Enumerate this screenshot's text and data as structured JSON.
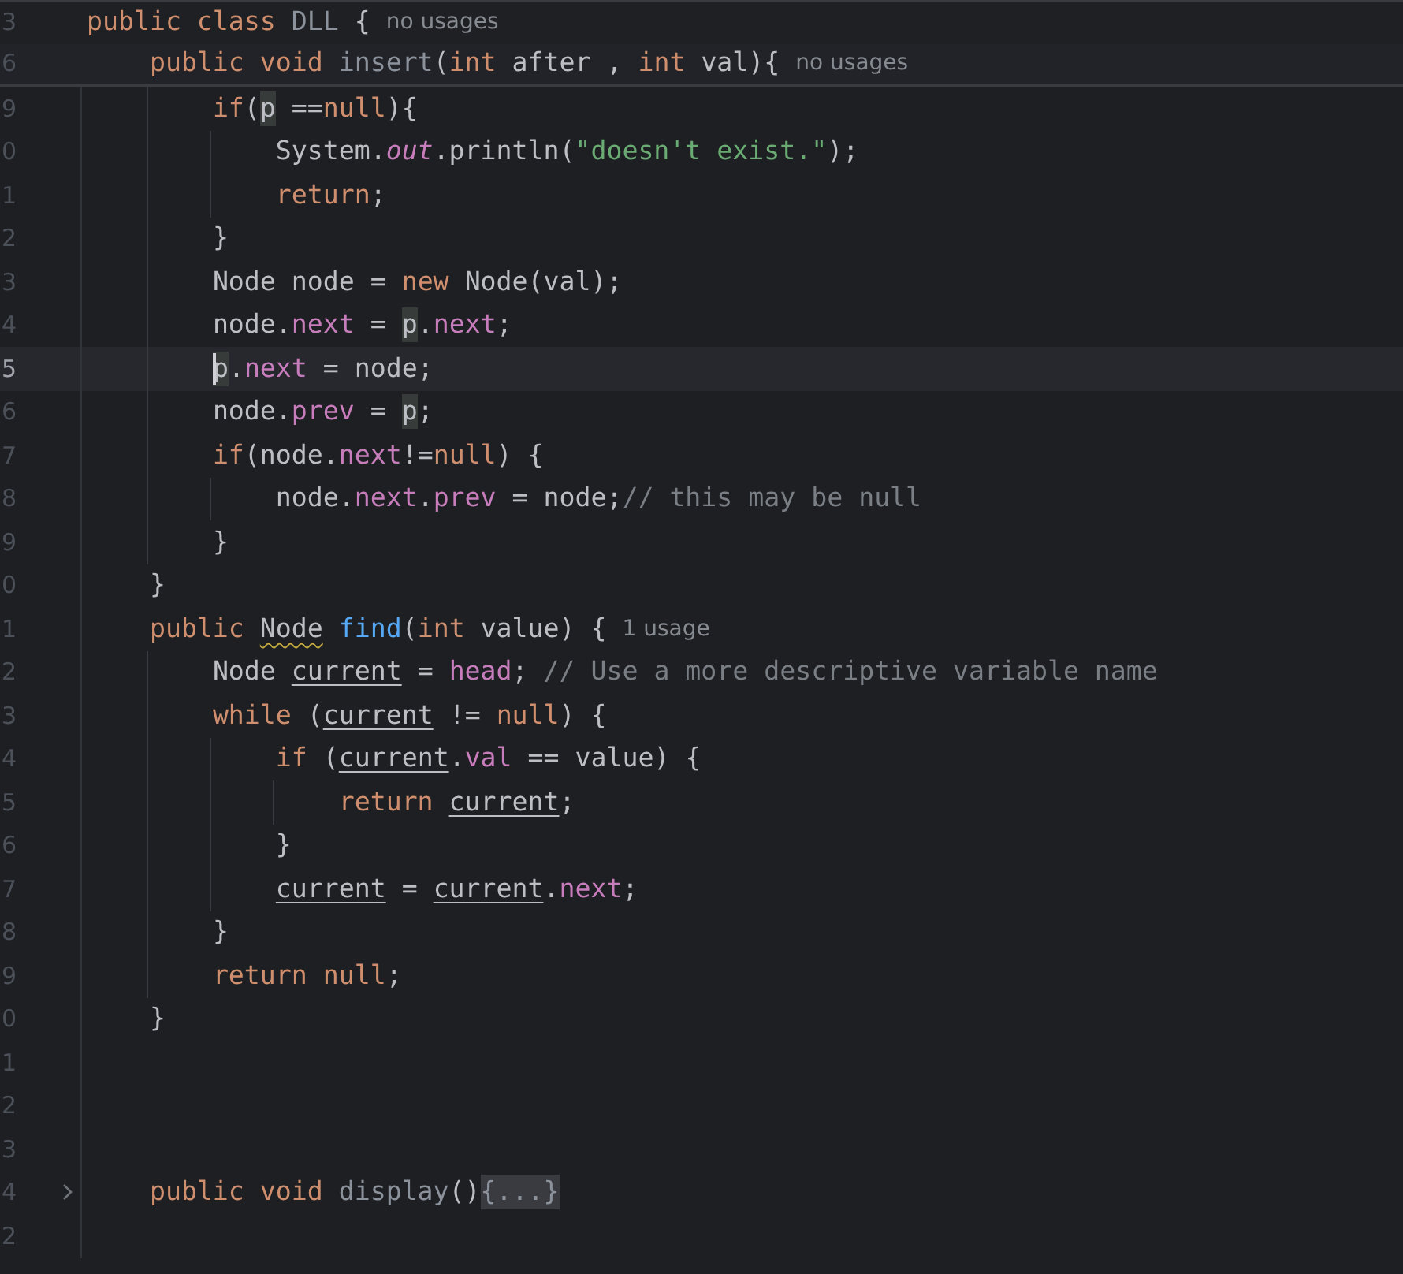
{
  "sticky_lines": [
    {
      "no": "3",
      "current": false,
      "folded": false,
      "tokens": [
        {
          "t": "public class ",
          "kind": "kw"
        },
        {
          "t": "DLL",
          "kind": "dim"
        },
        {
          "t": " {",
          "kind": "txt"
        },
        {
          "t": "no usages",
          "kind": "hint"
        }
      ]
    },
    {
      "no": "6",
      "current": false,
      "folded": false,
      "tokens": [
        {
          "t": "    public void ",
          "kind": "kw"
        },
        {
          "t": "insert",
          "kind": "dim"
        },
        {
          "t": "(",
          "kind": "txt"
        },
        {
          "t": "int ",
          "kind": "kw"
        },
        {
          "t": "after , ",
          "kind": "txt"
        },
        {
          "t": "int ",
          "kind": "kw"
        },
        {
          "t": "val){",
          "kind": "txt"
        },
        {
          "t": "no usages",
          "kind": "hint"
        }
      ]
    }
  ],
  "lines": [
    {
      "no": "9",
      "current": false,
      "folded": false,
      "tokens": [
        {
          "t": "        if",
          "kind": "kw"
        },
        {
          "t": "(",
          "kind": "txt"
        },
        {
          "t": "p",
          "kind": "occ"
        },
        {
          "t": " ==",
          "kind": "txt"
        },
        {
          "t": "null",
          "kind": "kw"
        },
        {
          "t": "){",
          "kind": "txt"
        }
      ]
    },
    {
      "no": "0",
      "current": false,
      "folded": false,
      "tokens": [
        {
          "t": "            System.",
          "kind": "txt"
        },
        {
          "t": "out",
          "kind": "static"
        },
        {
          "t": ".println(",
          "kind": "txt"
        },
        {
          "t": "\"doesn't exist.\"",
          "kind": "str"
        },
        {
          "t": ");",
          "kind": "txt"
        }
      ]
    },
    {
      "no": "1",
      "current": false,
      "folded": false,
      "tokens": [
        {
          "t": "            return",
          "kind": "kw"
        },
        {
          "t": ";",
          "kind": "txt"
        }
      ]
    },
    {
      "no": "2",
      "current": false,
      "folded": false,
      "tokens": [
        {
          "t": "        }",
          "kind": "txt"
        }
      ]
    },
    {
      "no": "3",
      "current": false,
      "folded": false,
      "tokens": [
        {
          "t": "        Node node = ",
          "kind": "txt"
        },
        {
          "t": "new",
          "kind": "kw"
        },
        {
          "t": " Node(val);",
          "kind": "txt"
        }
      ]
    },
    {
      "no": "4",
      "current": false,
      "folded": false,
      "tokens": [
        {
          "t": "        node.",
          "kind": "txt"
        },
        {
          "t": "next",
          "kind": "field"
        },
        {
          "t": " = ",
          "kind": "txt"
        },
        {
          "t": "p",
          "kind": "occ"
        },
        {
          "t": ".",
          "kind": "txt"
        },
        {
          "t": "next",
          "kind": "field"
        },
        {
          "t": ";",
          "kind": "txt"
        }
      ]
    },
    {
      "no": "5",
      "current": true,
      "folded": false,
      "tokens": [
        {
          "t": "        p",
          "kind": "occ"
        },
        {
          "t": ".",
          "kind": "txt"
        },
        {
          "t": "next",
          "kind": "field"
        },
        {
          "t": " = node;",
          "kind": "txt"
        }
      ]
    },
    {
      "no": "6",
      "current": false,
      "folded": false,
      "tokens": [
        {
          "t": "        node.",
          "kind": "txt"
        },
        {
          "t": "prev",
          "kind": "field"
        },
        {
          "t": " = ",
          "kind": "txt"
        },
        {
          "t": "p",
          "kind": "occ"
        },
        {
          "t": ";",
          "kind": "txt"
        }
      ]
    },
    {
      "no": "7",
      "current": false,
      "folded": false,
      "tokens": [
        {
          "t": "        if",
          "kind": "kw"
        },
        {
          "t": "(node.",
          "kind": "txt"
        },
        {
          "t": "next",
          "kind": "field"
        },
        {
          "t": "!=",
          "kind": "txt"
        },
        {
          "t": "null",
          "kind": "kw"
        },
        {
          "t": ") {",
          "kind": "txt"
        }
      ]
    },
    {
      "no": "8",
      "current": false,
      "folded": false,
      "tokens": [
        {
          "t": "            node.",
          "kind": "txt"
        },
        {
          "t": "next",
          "kind": "field"
        },
        {
          "t": ".",
          "kind": "txt"
        },
        {
          "t": "prev",
          "kind": "field"
        },
        {
          "t": " = node;",
          "kind": "txt"
        },
        {
          "t": "// this may be null",
          "kind": "cmt"
        }
      ]
    },
    {
      "no": "9",
      "current": false,
      "folded": false,
      "tokens": [
        {
          "t": "        }",
          "kind": "txt"
        }
      ]
    },
    {
      "no": "0",
      "current": false,
      "folded": false,
      "tokens": [
        {
          "t": "    }",
          "kind": "txt"
        }
      ]
    },
    {
      "no": "1",
      "current": false,
      "folded": false,
      "tokens": [
        {
          "t": "    public ",
          "kind": "kw"
        },
        {
          "t": "Node",
          "kind": "warn"
        },
        {
          "t": " find",
          "kind": "fn"
        },
        {
          "t": "(",
          "kind": "txt"
        },
        {
          "t": "int ",
          "kind": "kw"
        },
        {
          "t": "value) {",
          "kind": "txt"
        },
        {
          "t": "1 usage",
          "kind": "hint"
        }
      ]
    },
    {
      "no": "2",
      "current": false,
      "folded": false,
      "tokens": [
        {
          "t": "        Node ",
          "kind": "txt"
        },
        {
          "t": "current",
          "kind": "ul"
        },
        {
          "t": " = ",
          "kind": "txt"
        },
        {
          "t": "head",
          "kind": "field"
        },
        {
          "t": "; ",
          "kind": "txt"
        },
        {
          "t": "// Use a more descriptive variable name",
          "kind": "cmt"
        }
      ]
    },
    {
      "no": "3",
      "current": false,
      "folded": false,
      "tokens": [
        {
          "t": "        while",
          "kind": "kw"
        },
        {
          "t": " (",
          "kind": "txt"
        },
        {
          "t": "current",
          "kind": "ul"
        },
        {
          "t": " != ",
          "kind": "txt"
        },
        {
          "t": "null",
          "kind": "kw"
        },
        {
          "t": ") {",
          "kind": "txt"
        }
      ]
    },
    {
      "no": "4",
      "current": false,
      "folded": false,
      "tokens": [
        {
          "t": "            if",
          "kind": "kw"
        },
        {
          "t": " (",
          "kind": "txt"
        },
        {
          "t": "current",
          "kind": "ul"
        },
        {
          "t": ".",
          "kind": "txt"
        },
        {
          "t": "val",
          "kind": "field"
        },
        {
          "t": " == value) {",
          "kind": "txt"
        }
      ]
    },
    {
      "no": "5",
      "current": false,
      "folded": false,
      "tokens": [
        {
          "t": "                return ",
          "kind": "kw"
        },
        {
          "t": "current",
          "kind": "ul"
        },
        {
          "t": ";",
          "kind": "txt"
        }
      ]
    },
    {
      "no": "6",
      "current": false,
      "folded": false,
      "tokens": [
        {
          "t": "            }",
          "kind": "txt"
        }
      ]
    },
    {
      "no": "7",
      "current": false,
      "folded": false,
      "tokens": [
        {
          "t": "            current",
          "kind": "ul"
        },
        {
          "t": " = ",
          "kind": "txt"
        },
        {
          "t": "current",
          "kind": "ul"
        },
        {
          "t": ".",
          "kind": "txt"
        },
        {
          "t": "next",
          "kind": "field"
        },
        {
          "t": ";",
          "kind": "txt"
        }
      ]
    },
    {
      "no": "8",
      "current": false,
      "folded": false,
      "tokens": [
        {
          "t": "        }",
          "kind": "txt"
        }
      ]
    },
    {
      "no": "9",
      "current": false,
      "folded": false,
      "tokens": [
        {
          "t": "        return null",
          "kind": "kw"
        },
        {
          "t": ";",
          "kind": "txt"
        }
      ]
    },
    {
      "no": "0",
      "current": false,
      "folded": false,
      "tokens": [
        {
          "t": "    }",
          "kind": "txt"
        }
      ]
    },
    {
      "no": "1",
      "current": false,
      "folded": false
    },
    {
      "no": "2",
      "current": false,
      "folded": false
    },
    {
      "no": "3",
      "current": false,
      "folded": false
    },
    {
      "no": "4",
      "current": false,
      "folded": true,
      "tokens": [
        {
          "t": "    public void ",
          "kind": "kw"
        },
        {
          "t": "display",
          "kind": "dim"
        },
        {
          "t": "()",
          "kind": "txt"
        },
        {
          "t": "{...}",
          "kind": "fold"
        }
      ]
    },
    {
      "no": "2",
      "current": false,
      "folded": false
    }
  ]
}
